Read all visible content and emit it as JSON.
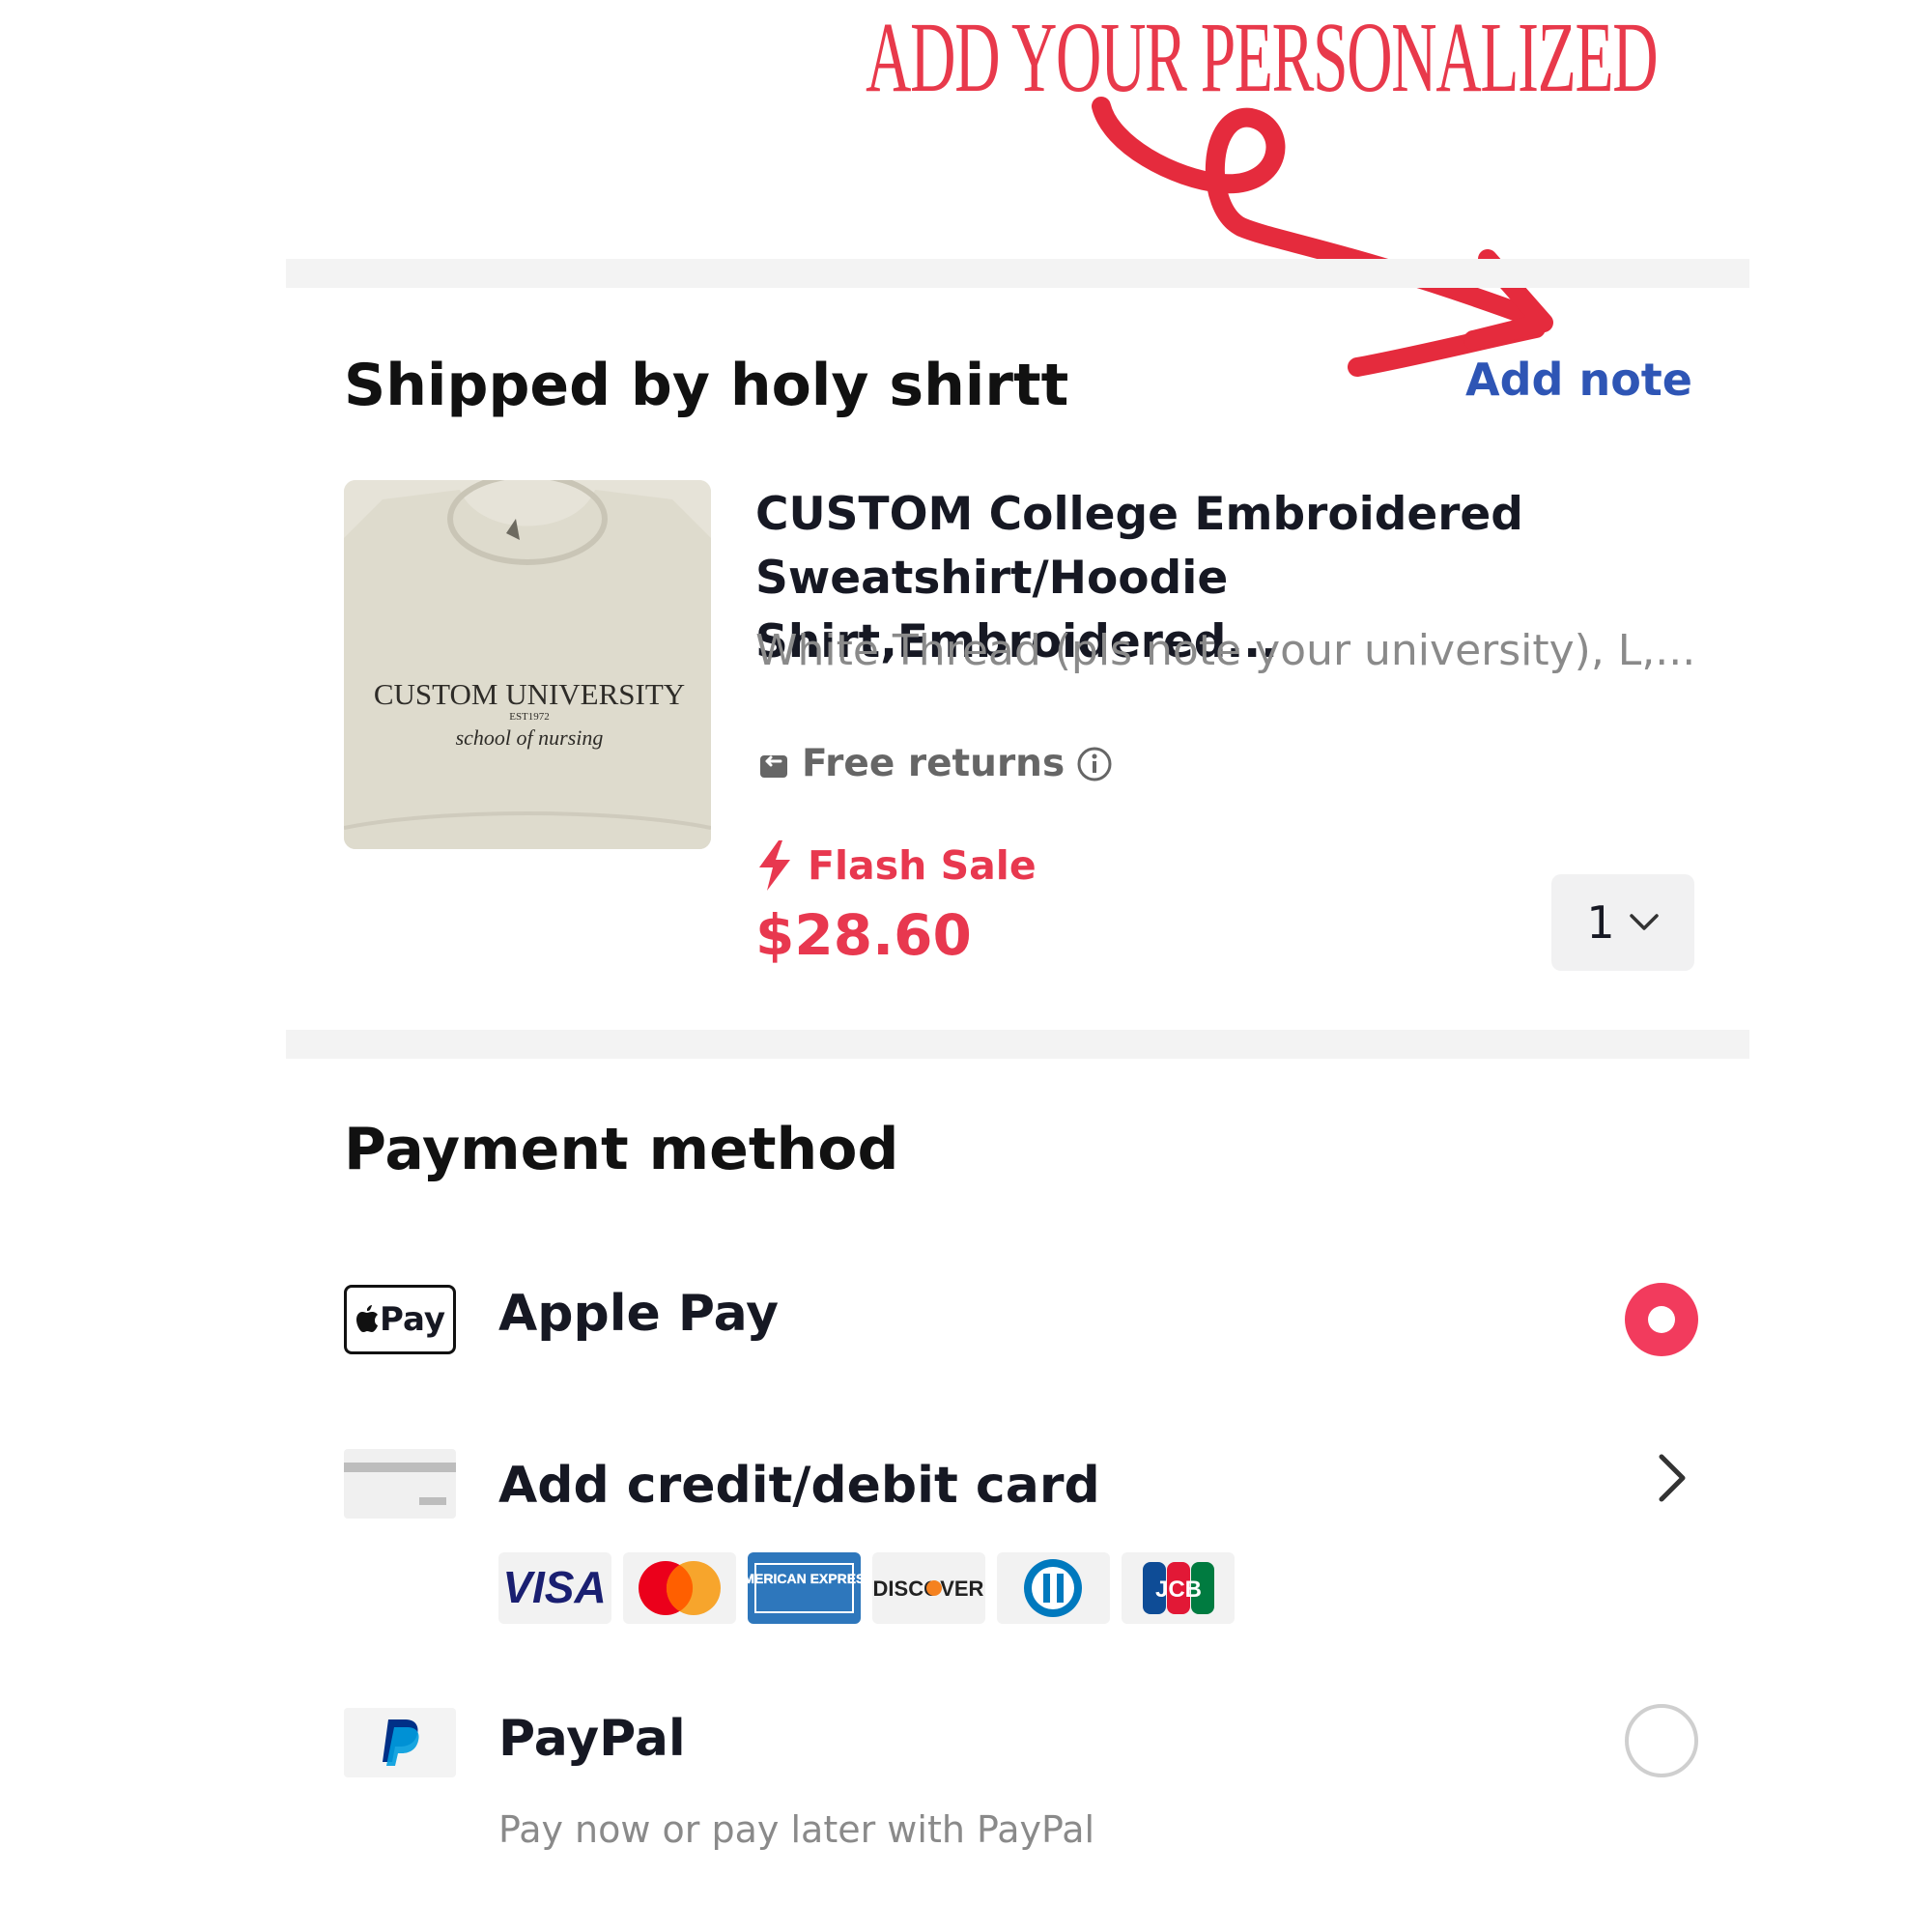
{
  "annotation": {
    "text": "ADD YOUR PERSONALIZED",
    "color": "#e8394b"
  },
  "shipping": {
    "title": "Shipped by holy shirtt",
    "add_note_label": "Add note"
  },
  "product": {
    "image_text": {
      "line1": "CUSTOM UNIVERSITY",
      "line2": "EST1972",
      "line3": "school of nursing"
    },
    "title": "CUSTOM College Embroidered Sweatshirt/Hoodie Shirt,Embroidered...",
    "variant": "White Thread (pls note your university), L,...",
    "free_returns": "Free returns",
    "flash_sale": "Flash Sale",
    "price": "$28.60",
    "quantity": "1"
  },
  "payment": {
    "title": "Payment method",
    "methods": [
      {
        "icon": "apple-pay-icon",
        "icon_label": "Pay",
        "label": "Apple Pay",
        "selected": true
      },
      {
        "icon": "credit-card-icon",
        "label": "Add credit/debit card"
      },
      {
        "icon": "paypal-icon",
        "label": "PayPal",
        "sub": "Pay now or pay later with PayPal",
        "selected": false
      }
    ],
    "card_brands": [
      "VISA",
      "Mastercard",
      "AMERICAN EXPRESS",
      "DISCOVER",
      "Diners Club",
      "JCB"
    ]
  },
  "colors": {
    "accent": "#f23b5d",
    "sale": "#e8384f",
    "link": "#2e55b5"
  }
}
